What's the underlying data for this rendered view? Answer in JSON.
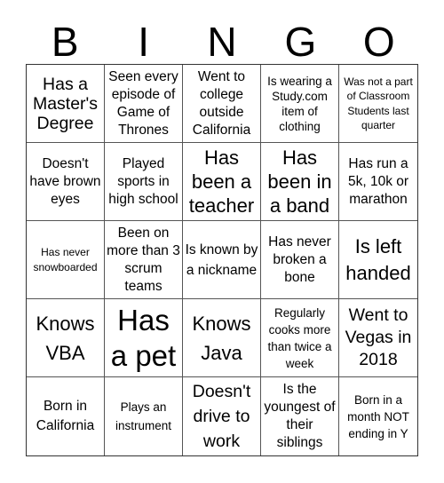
{
  "title_letters": [
    "B",
    "I",
    "N",
    "G",
    "O"
  ],
  "cells": [
    "Has a Master's Degree",
    "Seen every episode of Game of Thrones",
    "Went to college outside California",
    "Is wearing a Study.com item of clothing",
    "Was not a part of Classroom Students last quarter",
    "Doesn't have brown eyes",
    "Played sports in high school",
    "Has been a teacher",
    "Has been in a band",
    "Has run a 5k, 10k or marathon",
    "Has never snowboarded",
    "Been on more than 3 scrum teams",
    "Is known by a nickname",
    "Has never broken a bone",
    "Is left handed",
    "Knows VBA",
    "Has a pet",
    "Knows Java",
    "Regularly cooks more than twice a week",
    "Went to Vegas in 2018",
    "Born in California",
    "Plays an instrument",
    "Doesn't drive to work",
    "Is the youngest of their siblings",
    "Born in a month NOT ending in Y"
  ]
}
